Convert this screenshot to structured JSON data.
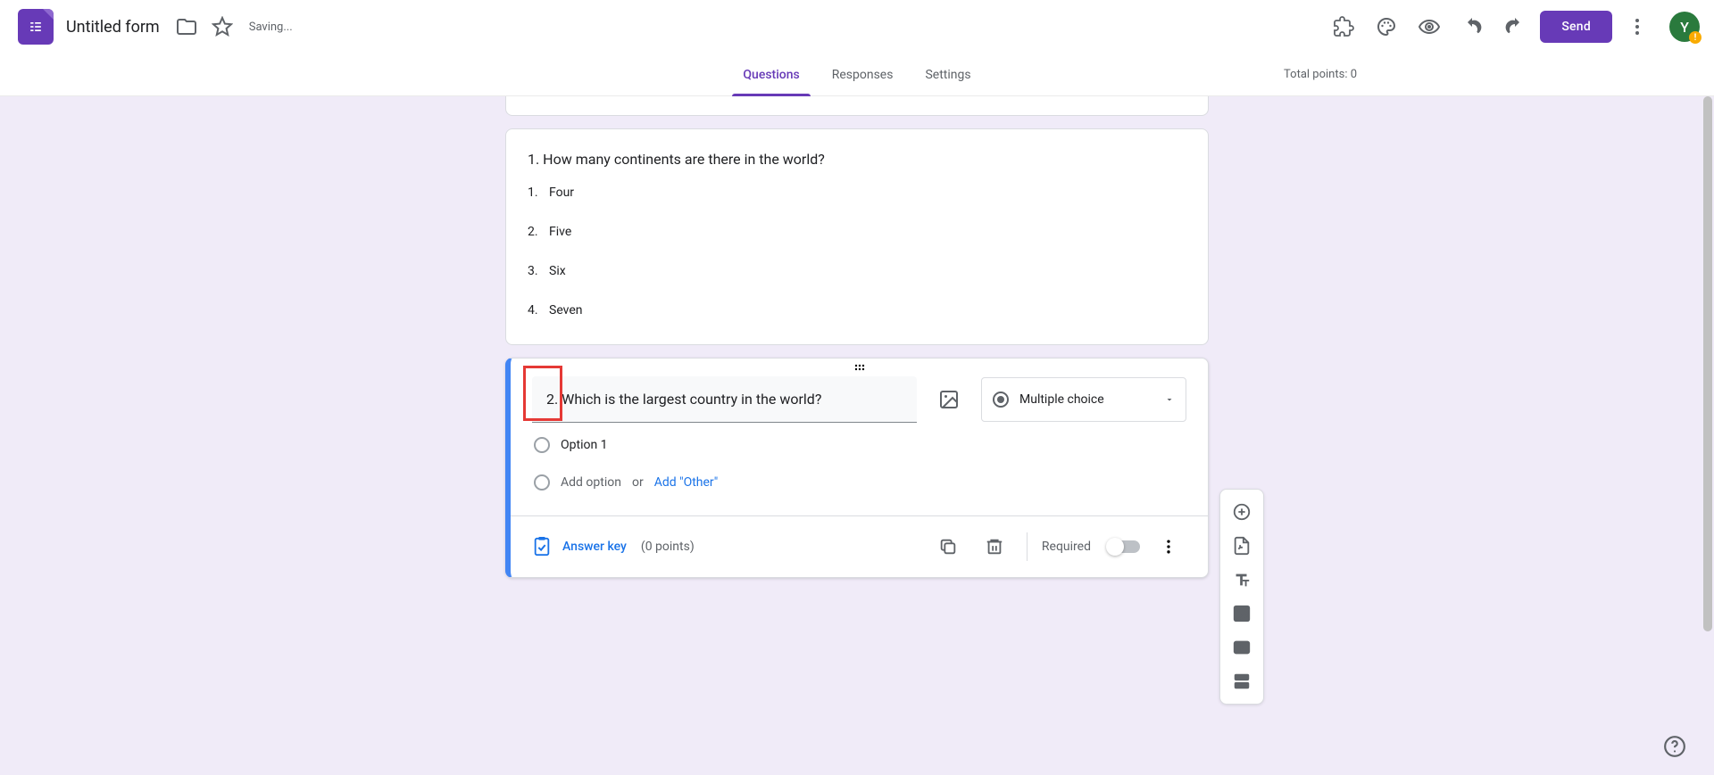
{
  "header": {
    "title": "Untitled form",
    "saving": "Saving...",
    "send": "Send",
    "avatar_initial": "Y",
    "avatar_badge": "!"
  },
  "tabs": {
    "questions": "Questions",
    "responses": "Responses",
    "settings": "Settings"
  },
  "points_label": "Total points: 0",
  "question1": {
    "title": "1. How many continents are there in the world?",
    "opts": [
      {
        "num": "1.",
        "label": "Four"
      },
      {
        "num": "2.",
        "label": "Five"
      },
      {
        "num": "3.",
        "label": "Six"
      },
      {
        "num": "4.",
        "label": "Seven"
      }
    ]
  },
  "question2": {
    "text": "2. Which is the largest country in the world?",
    "type_label": "Multiple choice",
    "option1": "Option 1",
    "add_option": "Add option",
    "or": "or",
    "add_other": "Add \"Other\"",
    "answer_key": "Answer key",
    "points": "(0 points)",
    "required": "Required"
  }
}
